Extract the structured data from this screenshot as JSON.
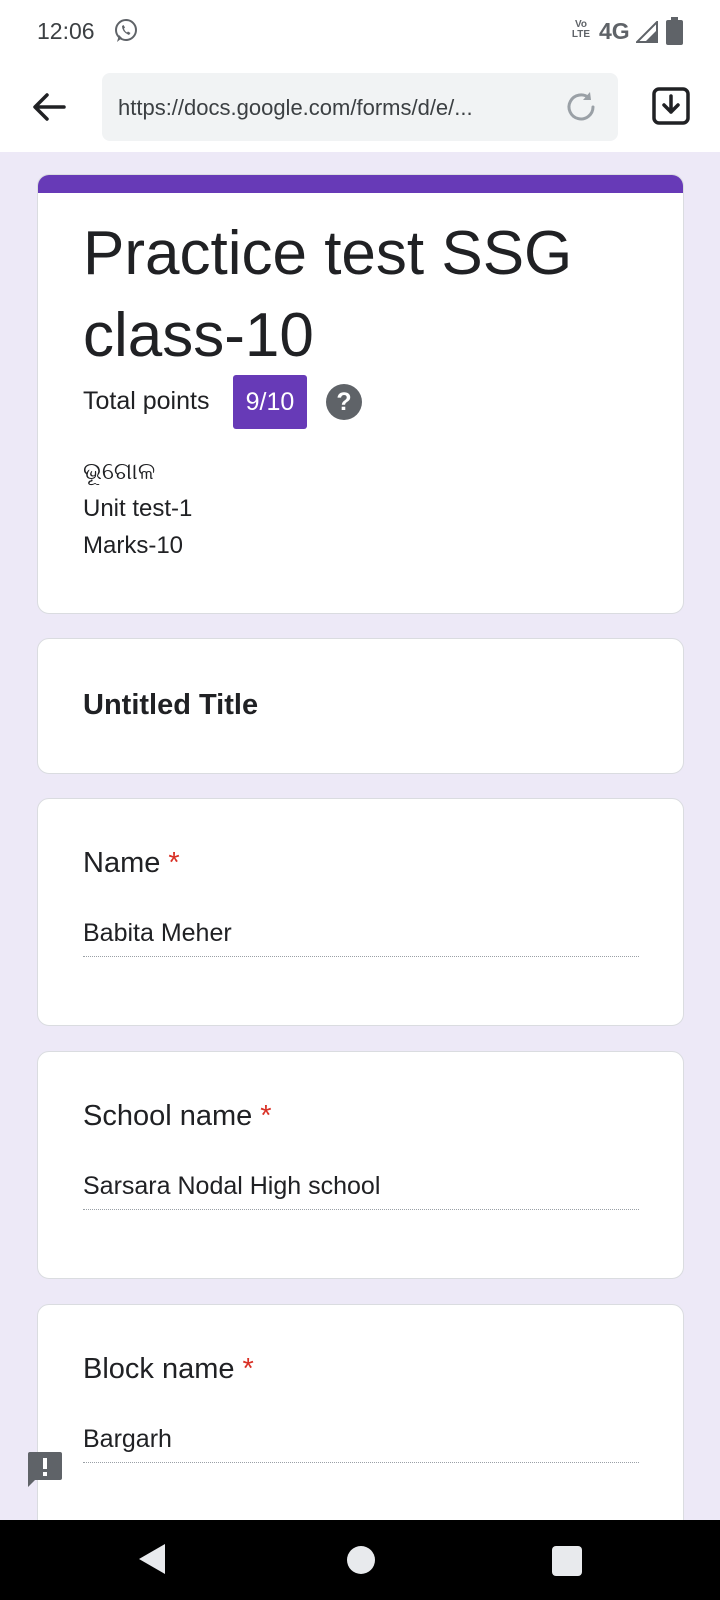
{
  "status_bar": {
    "time": "12:06",
    "volte_label": "Vo LTE",
    "network": "4G",
    "icons": [
      "whatsapp-icon",
      "signal-icon",
      "battery-icon"
    ]
  },
  "browser": {
    "url": "https://docs.google.com/forms/d/e/...",
    "icons": [
      "back-arrow-icon",
      "reload-icon",
      "download-icon"
    ]
  },
  "form": {
    "accent_color": "#673ab7",
    "background_color": "#ede9f7",
    "title": "Practice test SSG class-10",
    "points_label": "Total points",
    "points_value": "9/10",
    "help_symbol": "?",
    "description": [
      "ଭୂଗୋଳ",
      "Unit test-1",
      "Marks-10"
    ],
    "section_title": "Untitled Title",
    "questions": [
      {
        "label": "Name",
        "required_mark": "*",
        "answer": "Babita Meher"
      },
      {
        "label": "School name",
        "required_mark": "*",
        "answer": "Sarsara Nodal High school"
      },
      {
        "label": "Block name",
        "required_mark": "*",
        "answer": "Bargarh"
      }
    ]
  },
  "nav_bar": {
    "icons": [
      "nav-back-icon",
      "nav-home-icon",
      "nav-recents-icon"
    ]
  }
}
